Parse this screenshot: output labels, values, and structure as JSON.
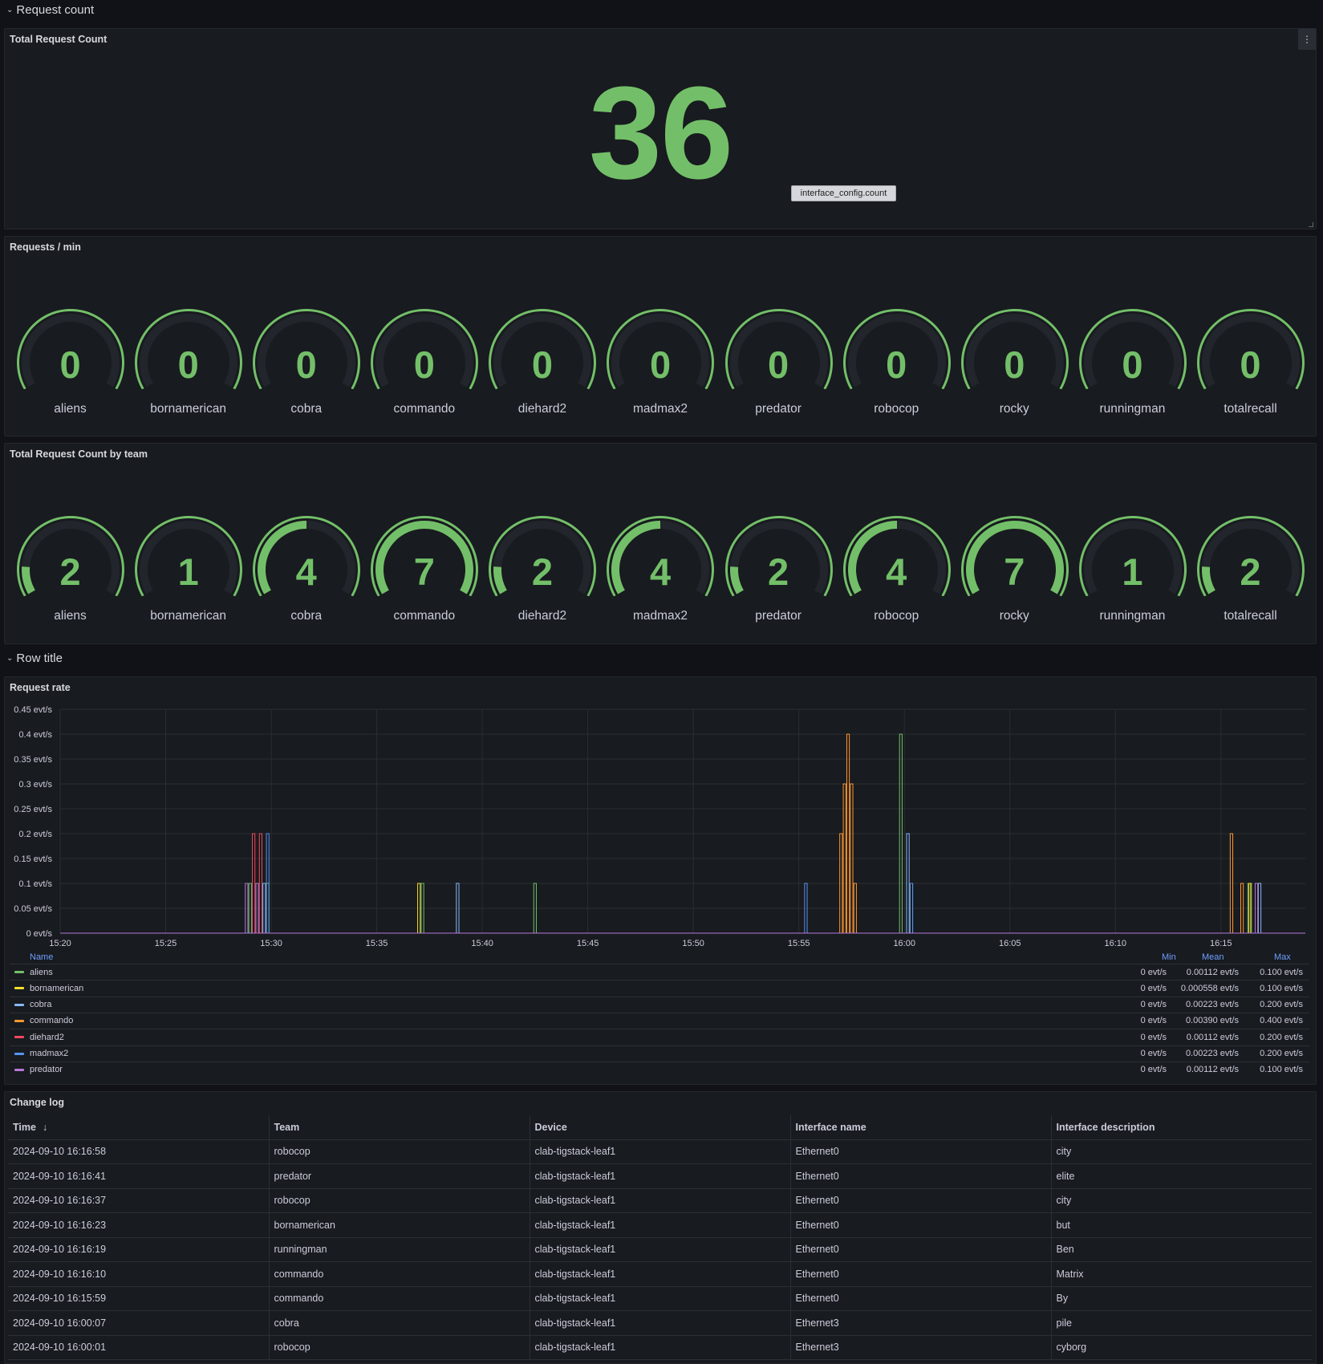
{
  "rows": {
    "row1_title": "Request count",
    "row2_title": "Row title"
  },
  "total_panel": {
    "title": "Total Request Count",
    "value": "36",
    "tooltip": "interface_config.count",
    "menu_icon": "kebab-menu-icon"
  },
  "rpm_panel": {
    "title": "Requests / min",
    "gauges": [
      {
        "label": "aliens",
        "value": "0",
        "fraction": 0
      },
      {
        "label": "bornamerican",
        "value": "0",
        "fraction": 0
      },
      {
        "label": "cobra",
        "value": "0",
        "fraction": 0
      },
      {
        "label": "commando",
        "value": "0",
        "fraction": 0
      },
      {
        "label": "diehard2",
        "value": "0",
        "fraction": 0
      },
      {
        "label": "madmax2",
        "value": "0",
        "fraction": 0
      },
      {
        "label": "predator",
        "value": "0",
        "fraction": 0
      },
      {
        "label": "robocop",
        "value": "0",
        "fraction": 0
      },
      {
        "label": "rocky",
        "value": "0",
        "fraction": 0
      },
      {
        "label": "runningman",
        "value": "0",
        "fraction": 0
      },
      {
        "label": "totalrecall",
        "value": "0",
        "fraction": 0
      }
    ]
  },
  "team_panel": {
    "title": "Total Request Count by team",
    "gauges": [
      {
        "label": "aliens",
        "value": "2",
        "fraction": 0.14
      },
      {
        "label": "bornamerican",
        "value": "1",
        "fraction": 0
      },
      {
        "label": "cobra",
        "value": "4",
        "fraction": 0.5
      },
      {
        "label": "commando",
        "value": "7",
        "fraction": 1
      },
      {
        "label": "diehard2",
        "value": "2",
        "fraction": 0.14
      },
      {
        "label": "madmax2",
        "value": "4",
        "fraction": 0.5
      },
      {
        "label": "predator",
        "value": "2",
        "fraction": 0.14
      },
      {
        "label": "robocop",
        "value": "4",
        "fraction": 0.5
      },
      {
        "label": "rocky",
        "value": "7",
        "fraction": 1
      },
      {
        "label": "runningman",
        "value": "1",
        "fraction": 0
      },
      {
        "label": "totalrecall",
        "value": "2",
        "fraction": 0.14
      }
    ]
  },
  "colors": {
    "green": "#73bf69",
    "yellow": "#fade2a",
    "blue": "#8ab8ff",
    "orange": "#ff9830",
    "red": "#f2495c",
    "dark_blue": "#5794f2",
    "purple": "#b877d9",
    "gauge_track": "#22252b"
  },
  "rate_panel": {
    "title": "Request rate",
    "legend_headers": {
      "name": "Name",
      "min": "Min",
      "mean": "Mean",
      "max": "Max"
    },
    "legend": [
      {
        "name": "aliens",
        "color": "#73bf69",
        "min": "0 evt/s",
        "mean": "0.00112 evt/s",
        "max": "0.100 evt/s"
      },
      {
        "name": "bornamerican",
        "color": "#fade2a",
        "min": "0 evt/s",
        "mean": "0.000558 evt/s",
        "max": "0.100 evt/s"
      },
      {
        "name": "cobra",
        "color": "#8ab8ff",
        "min": "0 evt/s",
        "mean": "0.00223 evt/s",
        "max": "0.200 evt/s"
      },
      {
        "name": "commando",
        "color": "#ff9830",
        "min": "0 evt/s",
        "mean": "0.00390 evt/s",
        "max": "0.400 evt/s"
      },
      {
        "name": "diehard2",
        "color": "#f2495c",
        "min": "0 evt/s",
        "mean": "0.00112 evt/s",
        "max": "0.200 evt/s"
      },
      {
        "name": "madmax2",
        "color": "#5794f2",
        "min": "0 evt/s",
        "mean": "0.00223 evt/s",
        "max": "0.200 evt/s"
      },
      {
        "name": "predator",
        "color": "#b877d9",
        "min": "0 evt/s",
        "mean": "0.00112 evt/s",
        "max": "0.100 evt/s"
      }
    ]
  },
  "chart_data": {
    "type": "line",
    "title": "Request rate",
    "y_ticks": [
      "0 evt/s",
      "0.05 evt/s",
      "0.1 evt/s",
      "0.15 evt/s",
      "0.2 evt/s",
      "0.25 evt/s",
      "0.3 evt/s",
      "0.35 evt/s",
      "0.4 evt/s",
      "0.45 evt/s"
    ],
    "x_ticks": [
      "15:20",
      "15:25",
      "15:30",
      "15:35",
      "15:40",
      "15:45",
      "15:50",
      "15:55",
      "16:00",
      "16:05",
      "16:10",
      "16:15"
    ],
    "ylim": [
      0,
      0.45
    ],
    "xlim": [
      "15:20",
      "16:19"
    ],
    "grid": true,
    "series": [
      {
        "name": "aliens",
        "spikes": [
          [
            "15:29:00",
            0.1
          ],
          [
            "15:29:50",
            0.1
          ],
          [
            "15:37:10",
            0.1
          ],
          [
            "15:42:30",
            0.1
          ],
          [
            "15:59:50",
            0.4
          ],
          [
            "16:00:20",
            0.1
          ],
          [
            "16:16:20",
            0.1
          ]
        ]
      },
      {
        "name": "bornamerican",
        "spikes": [
          [
            "15:37:00",
            0.1
          ],
          [
            "16:16:23",
            0.1
          ]
        ]
      },
      {
        "name": "cobra",
        "spikes": [
          [
            "15:29:40",
            0.1
          ],
          [
            "15:38:50",
            0.1
          ],
          [
            "16:00:10",
            0.2
          ],
          [
            "16:16:50",
            0.1
          ]
        ]
      },
      {
        "name": "commando",
        "spikes": [
          [
            "15:57:00",
            0.2
          ],
          [
            "15:57:10",
            0.3
          ],
          [
            "15:57:20",
            0.4
          ],
          [
            "15:57:30",
            0.3
          ],
          [
            "15:57:40",
            0.1
          ],
          [
            "16:15:30",
            0.2
          ],
          [
            "16:16:00",
            0.1
          ]
        ]
      },
      {
        "name": "diehard2",
        "spikes": [
          [
            "15:29:10",
            0.2
          ],
          [
            "15:29:30",
            0.2
          ]
        ]
      },
      {
        "name": "madmax2",
        "spikes": [
          [
            "15:29:20",
            0.1
          ],
          [
            "15:29:50",
            0.2
          ],
          [
            "15:55:20",
            0.1
          ],
          [
            "16:00:20",
            0.1
          ]
        ]
      },
      {
        "name": "predator",
        "spikes": [
          [
            "15:28:50",
            0.1
          ],
          [
            "15:29:20",
            0.1
          ],
          [
            "16:16:41",
            0.1
          ]
        ]
      }
    ]
  },
  "changelog": {
    "title": "Change log",
    "sort_icon": "arrow-down-icon",
    "columns": [
      "Time",
      "Team",
      "Device",
      "Interface name",
      "Interface description"
    ],
    "rows": [
      [
        "2024-09-10 16:16:58",
        "robocop",
        "clab-tigstack-leaf1",
        "Ethernet0",
        "city"
      ],
      [
        "2024-09-10 16:16:41",
        "predator",
        "clab-tigstack-leaf1",
        "Ethernet0",
        "elite"
      ],
      [
        "2024-09-10 16:16:37",
        "robocop",
        "clab-tigstack-leaf1",
        "Ethernet0",
        "city"
      ],
      [
        "2024-09-10 16:16:23",
        "bornamerican",
        "clab-tigstack-leaf1",
        "Ethernet0",
        "but"
      ],
      [
        "2024-09-10 16:16:19",
        "runningman",
        "clab-tigstack-leaf1",
        "Ethernet0",
        "Ben"
      ],
      [
        "2024-09-10 16:16:10",
        "commando",
        "clab-tigstack-leaf1",
        "Ethernet0",
        "Matrix"
      ],
      [
        "2024-09-10 16:15:59",
        "commando",
        "clab-tigstack-leaf1",
        "Ethernet0",
        "By"
      ],
      [
        "2024-09-10 16:00:07",
        "cobra",
        "clab-tigstack-leaf1",
        "Ethernet3",
        "pile"
      ],
      [
        "2024-09-10 16:00:01",
        "robocop",
        "clab-tigstack-leaf1",
        "Ethernet3",
        "cyborg"
      ]
    ]
  }
}
